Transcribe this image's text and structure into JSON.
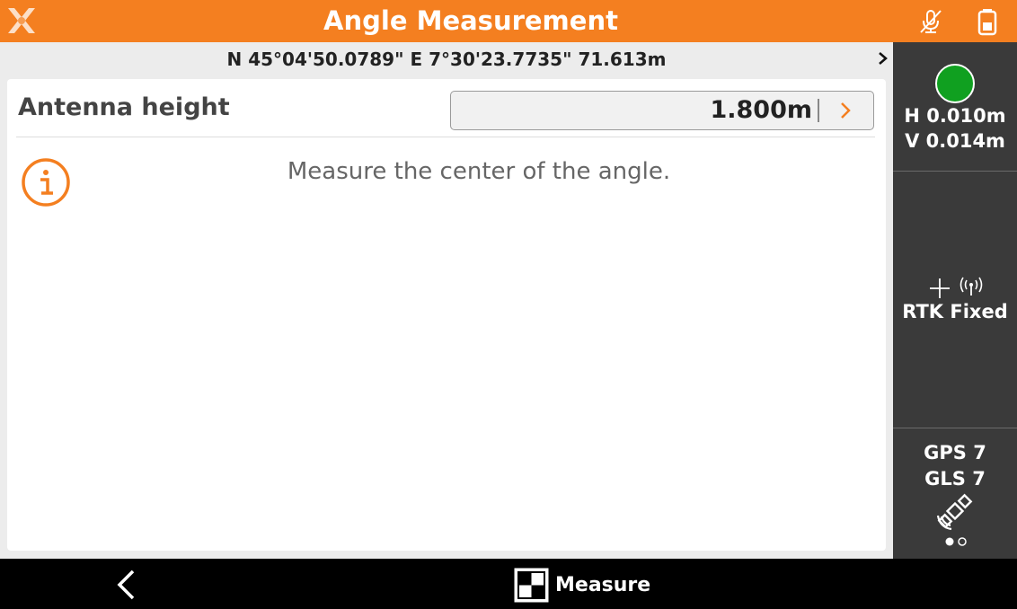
{
  "header": {
    "title": "Angle Measurement",
    "logo_icon": "x-logo-icon",
    "mic_icon": "mic-off-icon",
    "battery_icon": "battery-icon",
    "accent_color": "#f47f20"
  },
  "coordinate_bar": {
    "text": "N 45°04'50.0789\" E 7°30'23.7735\" 71.613m"
  },
  "form": {
    "antenna_label": "Antenna height",
    "antenna_value": "1.800m"
  },
  "message": {
    "text": "Measure the center of the angle."
  },
  "sidebar": {
    "status_color": "#10a020",
    "h_precision": "H 0.010m",
    "v_precision": "V 0.014m",
    "solution": "RTK Fixed",
    "gps": "GPS 7",
    "glonass": "GLS 7"
  },
  "bottom_bar": {
    "measure_label": "Measure"
  }
}
